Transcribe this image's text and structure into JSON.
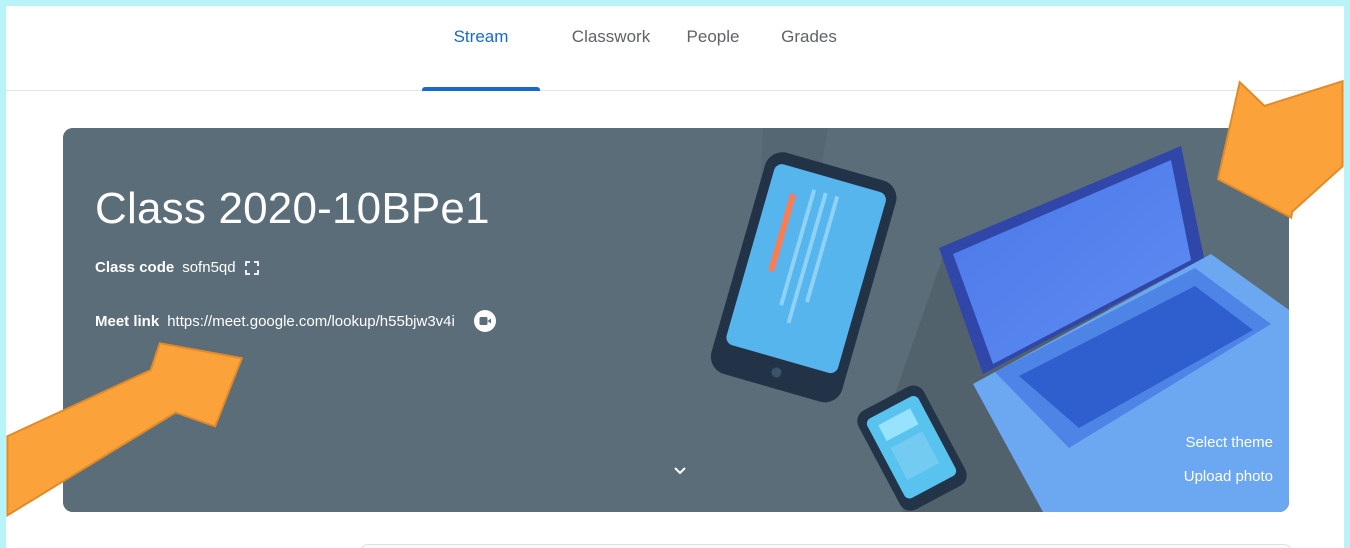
{
  "nav": {
    "tabs": [
      {
        "label": "Stream",
        "active": true
      },
      {
        "label": "Classwork",
        "active": false
      },
      {
        "label": "People",
        "active": false
      },
      {
        "label": "Grades",
        "active": false
      }
    ]
  },
  "banner": {
    "title": "Class 2020-10BPe1",
    "class_code_label": "Class code",
    "class_code": "sofn5qd",
    "meet_link_label": "Meet link",
    "meet_link": "https://meet.google.com/lookup/h55bjw3v4i",
    "select_theme": "Select theme",
    "upload_photo": "Upload photo"
  },
  "icons": {
    "fullscreen": "fullscreen-icon",
    "meet": "google-meet-icon",
    "expand": "chevron-down-icon"
  },
  "colors": {
    "accent": "#1967d2",
    "banner": "#5a6d78",
    "arrow": "#fba33a",
    "frame": "#b8f3f7"
  }
}
